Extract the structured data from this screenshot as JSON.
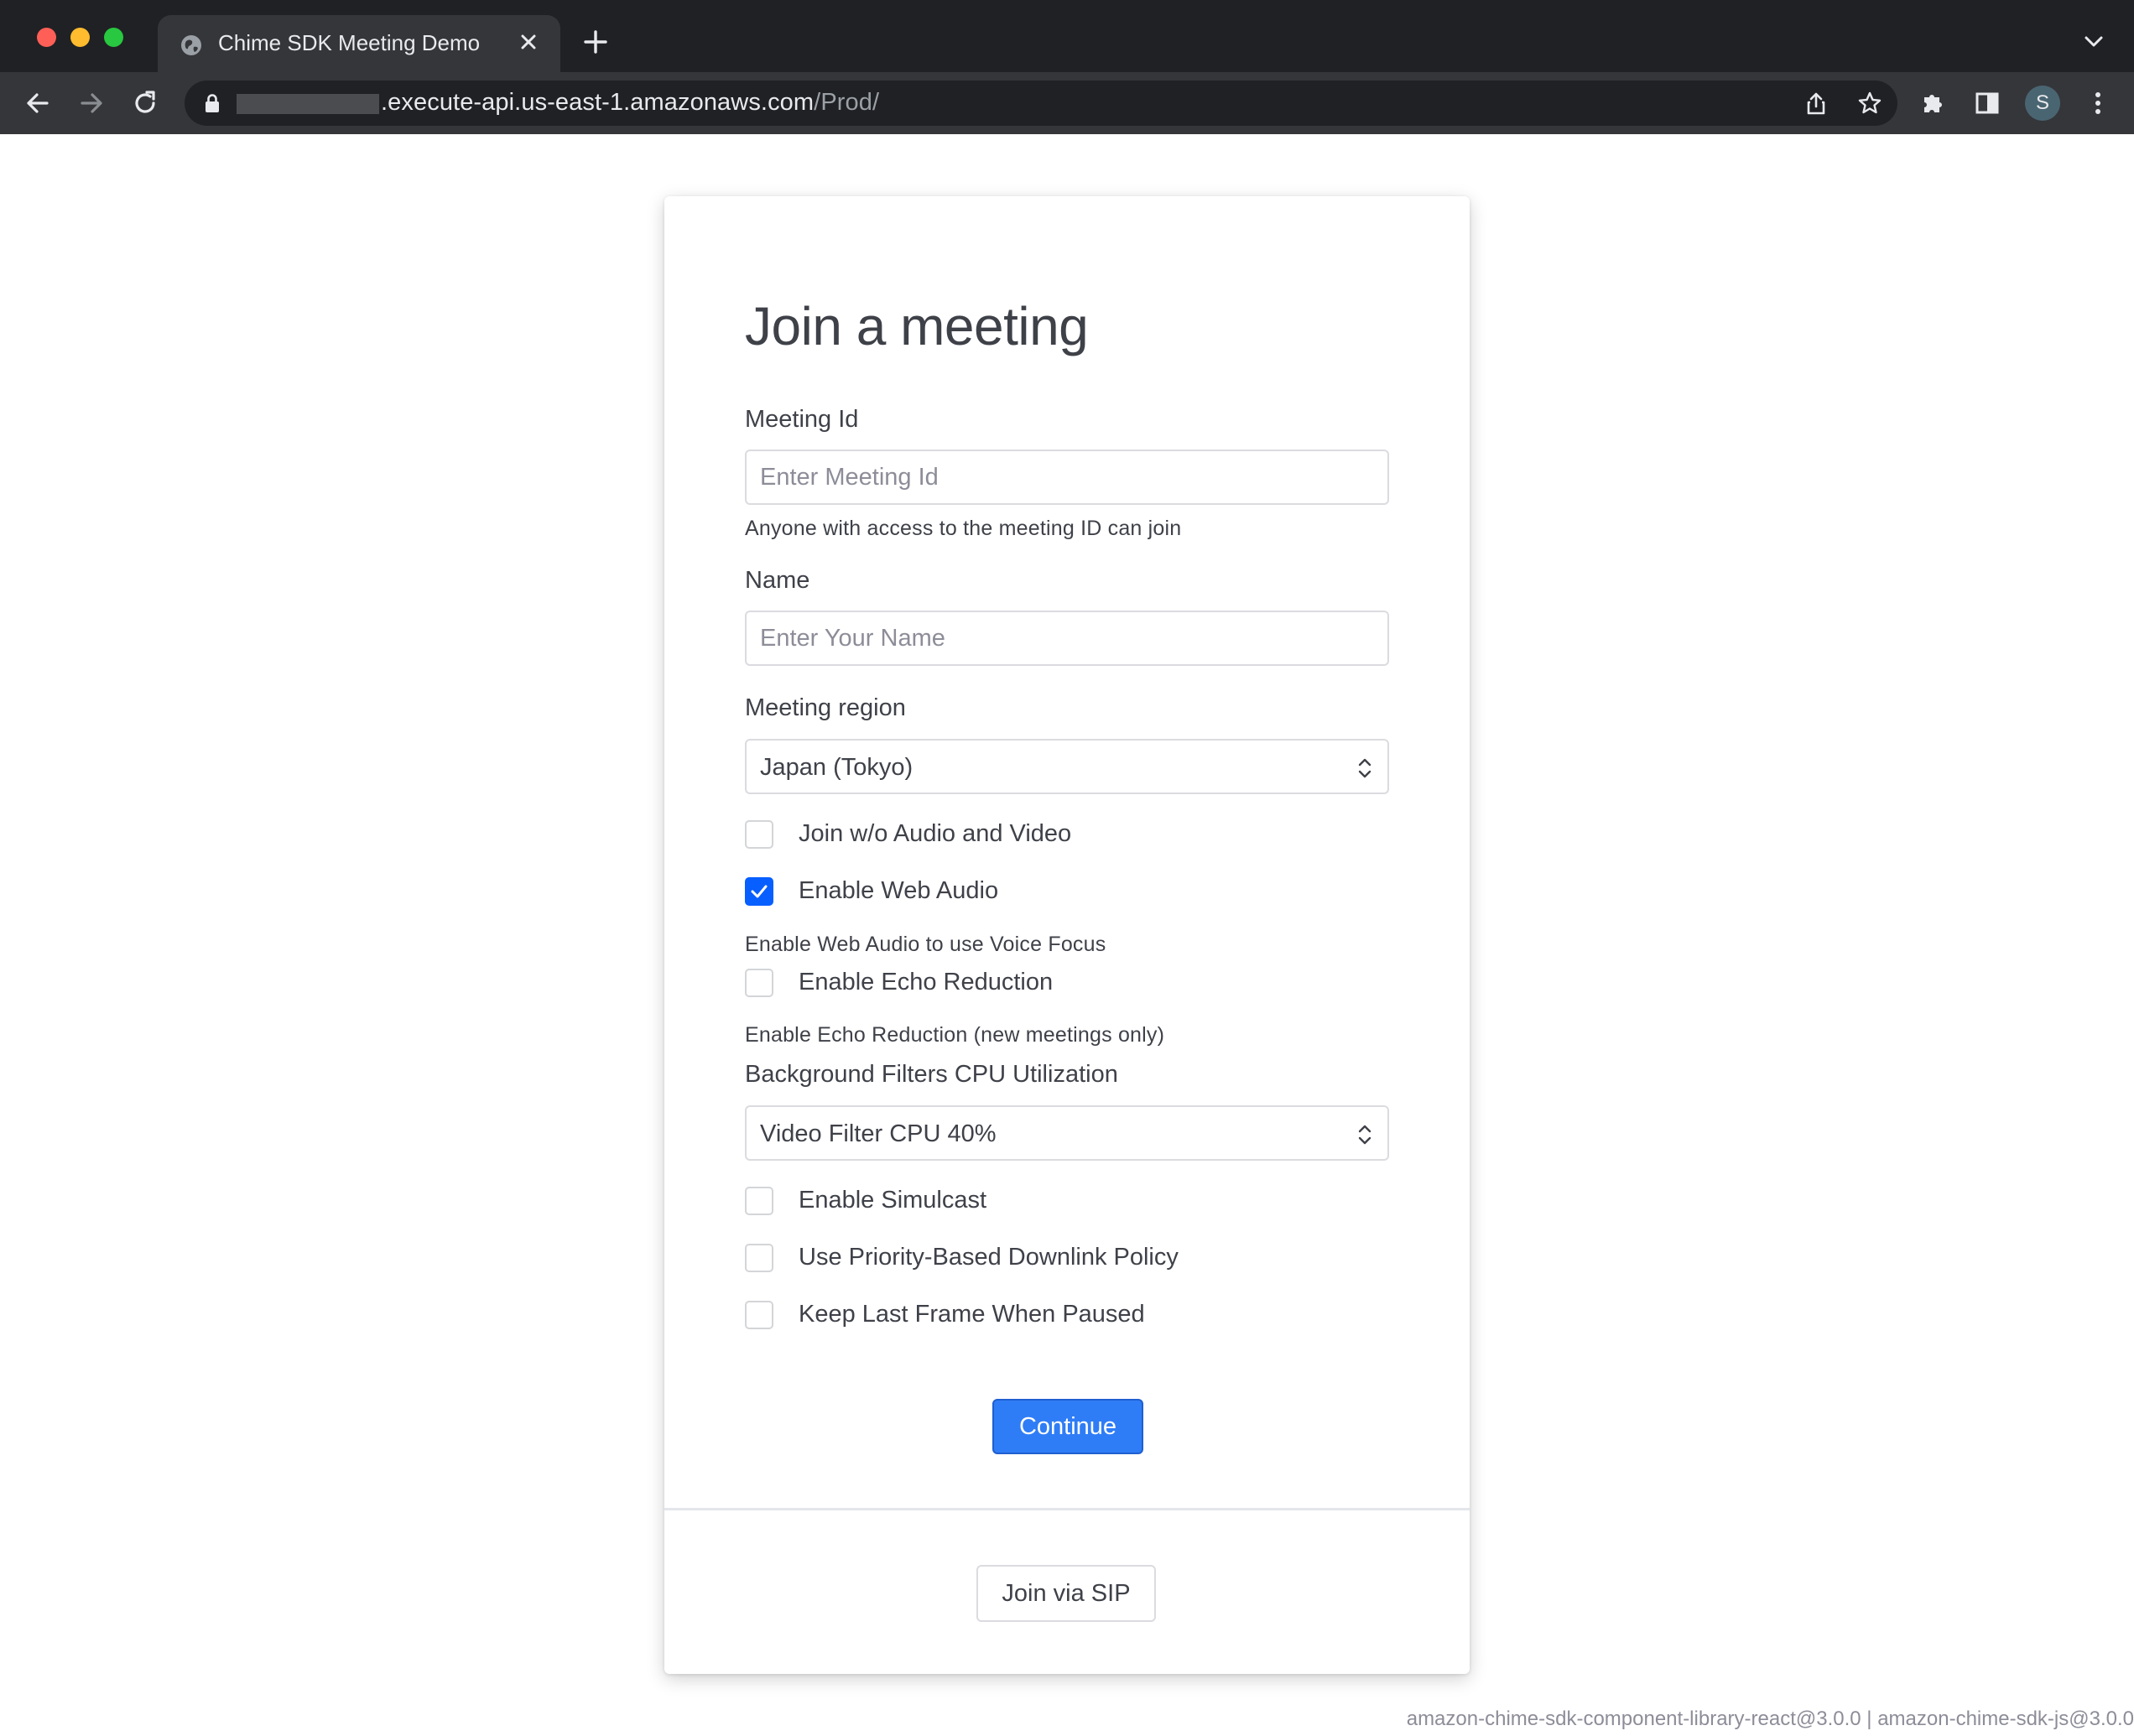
{
  "browser": {
    "tab_title": "Chime SDK Meeting Demo",
    "url_host_visible": ".execute-api.us-east-1.amazonaws.com",
    "url_path": "/Prod/",
    "profile_initial": "S"
  },
  "form": {
    "title": "Join a meeting",
    "meeting_id": {
      "label": "Meeting Id",
      "placeholder": "Enter Meeting Id",
      "value": "",
      "hint": "Anyone with access to the meeting ID can join"
    },
    "name": {
      "label": "Name",
      "placeholder": "Enter Your Name",
      "value": ""
    },
    "region": {
      "label": "Meeting region",
      "selected": "Japan (Tokyo)"
    },
    "checkboxes": {
      "no_audio_video": {
        "label": "Join w/o Audio and Video",
        "checked": false
      },
      "web_audio": {
        "label": "Enable Web Audio",
        "checked": true,
        "hint": "Enable Web Audio to use Voice Focus"
      },
      "echo_reduction": {
        "label": "Enable Echo Reduction",
        "checked": false,
        "hint": "Enable Echo Reduction (new meetings only)"
      },
      "simulcast": {
        "label": "Enable Simulcast",
        "checked": false
      },
      "priority_downlink": {
        "label": "Use Priority-Based Downlink Policy",
        "checked": false
      },
      "keep_last_frame": {
        "label": "Keep Last Frame When Paused",
        "checked": false
      }
    },
    "cpu": {
      "label": "Background Filters CPU Utilization",
      "selected": "Video Filter CPU 40%"
    },
    "continue_label": "Continue",
    "sip_label": "Join via SIP"
  },
  "footer": {
    "versions": "amazon-chime-sdk-component-library-react@3.0.0 | amazon-chime-sdk-js@3.0.0"
  },
  "colors": {
    "primary": "#2f7df6",
    "checkbox_checked": "#075fff",
    "chrome_dark": "#202124",
    "chrome_tab": "#35363a"
  }
}
